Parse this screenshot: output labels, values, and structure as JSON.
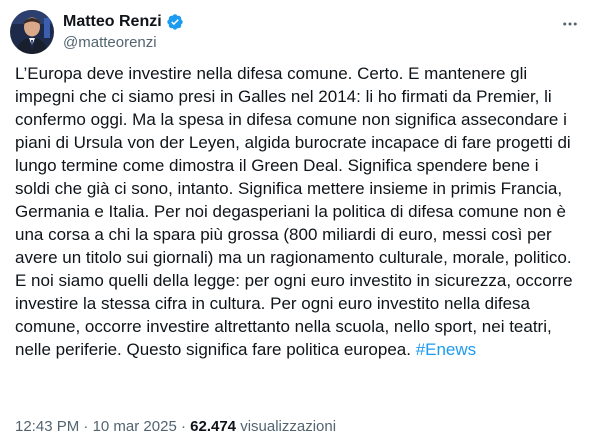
{
  "author": {
    "display_name": "Matteo Renzi",
    "handle": "@matteorenzi",
    "verified": true,
    "verified_color": "#1d9bf0"
  },
  "more_icon": "more-horizontal-icon",
  "tweet": {
    "paragraph1": "L’Europa deve investire nella difesa comune. Certo. E mantenere gli impegni che ci siamo presi in Galles nel 2014: li ho firmati da Premier, li confermo oggi. Ma la spesa in difesa comune non significa assecondare i piani di Ursula von der Leyen, algida burocrate incapace di fare progetti di lungo termine come dimostra il Green Deal. Significa spendere bene i soldi che già ci sono, intanto. Significa mettere insieme in primis Francia, Germania e Italia. Per noi degasperiani la politica di difesa comune non è una corsa a chi la spara più grossa (800 miliardi di euro, messi così per avere un titolo sui giornali) ma un ragionamento culturale, morale, politico.",
    "paragraph2": "E noi siamo quelli della legge: per ogni euro investito in sicurezza, occorre investire la stessa cifra in cultura. Per ogni euro investito nella difesa comune, occorre investire altrettanto nella scuola, nello sport, nei teatri, nelle periferie. Questo significa fare politica europea.",
    "hashtag": "#Enews"
  },
  "meta": {
    "time": "12:43 PM",
    "separator": "·",
    "date": "10 mar 2025",
    "views_count": "62.474",
    "views_label": "visualizzazioni"
  },
  "colors": {
    "text": "#0f1419",
    "secondary": "#536471",
    "link": "#1d9bf0"
  }
}
